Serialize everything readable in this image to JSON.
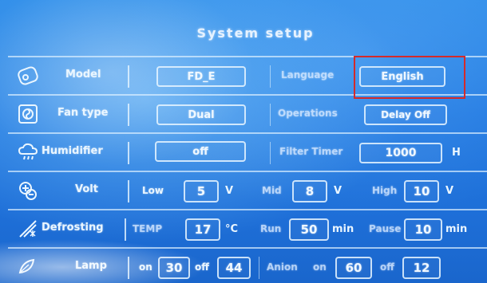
{
  "title": "System setup",
  "rows": {
    "model": {
      "label": "Model",
      "value": "FD_E",
      "icon": "fan-outline-icon",
      "right_label": "Language",
      "right_value": "English"
    },
    "fan": {
      "label": "Fan type",
      "value": "Dual",
      "icon": "fan-square-icon",
      "right_label": "Operations",
      "right_value": "Delay Off"
    },
    "humidifier": {
      "label": "Humidifier",
      "value": "off",
      "icon": "cloud-drops-icon",
      "right_label": "Filter Timer",
      "right_value": "1000",
      "right_unit": "H"
    },
    "volt": {
      "label": "Volt",
      "icon": "plus-minus-icon",
      "low_label": "Low",
      "low_value": "5",
      "low_unit": "V",
      "mid_label": "Mid",
      "mid_value": "8",
      "mid_unit": "V",
      "high_label": "High",
      "high_value": "10",
      "high_unit": "V"
    },
    "defrosting": {
      "label": "Defrosting",
      "icon": "snowflake-slash-icon",
      "temp_label": "TEMP",
      "temp_value": "17",
      "temp_unit": "°C",
      "run_label": "Run",
      "run_value": "50",
      "run_unit": "min",
      "pause_label": "Pause",
      "pause_value": "10",
      "pause_unit": "min"
    },
    "lamp": {
      "label": "Lamp",
      "icon": "leaf-lamp-icon",
      "on_label": "on",
      "on_value": "30",
      "off_label": "off",
      "off_value": "44",
      "anion_label": "Anion",
      "anion_on_label": "on",
      "anion_on_value": "60",
      "anion_off_label": "off",
      "anion_off_value": "12"
    }
  },
  "annotation_color": "#d42a2a"
}
